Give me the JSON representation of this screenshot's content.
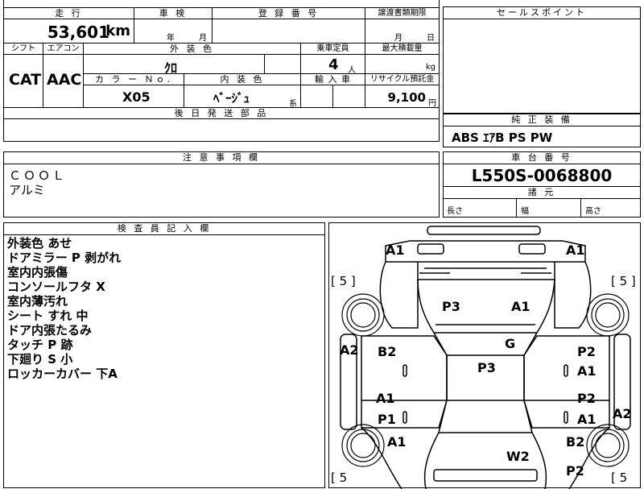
{
  "top": {
    "headers": {
      "mileage": "走 行",
      "inspection": "車 検",
      "registration": "登 録 番 号",
      "transfer_deadline": "譲渡書類期限"
    },
    "mileage_value": "53,601",
    "mileage_unit": "km",
    "inspection_year": "年",
    "inspection_month": "月",
    "deadline_month": "月",
    "deadline_day": "日",
    "headers2": {
      "shift": "シフト",
      "aircon": "エアコン",
      "exterior_color": "外 装 色",
      "capacity": "乗車定員",
      "max_load": "最大積載量"
    },
    "shift_value": "CAT",
    "aircon_value": "AAC",
    "exterior_color_value": "ｸﾛ",
    "capacity_value": "4",
    "capacity_unit": "人",
    "load_unit": "kg",
    "headers3": {
      "color_no": "カ ラ ー Ｎｏ.",
      "interior_color": "内 装 色",
      "import": "輸 入 車",
      "recycle": "リサイクル預託金"
    },
    "color_no_value": "X05",
    "interior_color_value": "ﾍﾞｰｼﾞｭ",
    "interior_color_suffix": "系",
    "recycle_value": "9,100",
    "recycle_unit": "円",
    "later_parts": "後 日 発 送 部 品"
  },
  "sales_point": {
    "header": "セールスポイント"
  },
  "equipment": {
    "header": "純 正 装 備",
    "value": "ABS ｴｱB PS PW"
  },
  "caution": {
    "header": "注 意 事 項 欄",
    "lines": [
      "ＣＯＯＬ",
      "アルミ"
    ]
  },
  "chassis": {
    "header": "車 台 番 号",
    "value": "L550S-0068800",
    "spec_header": "諸 元",
    "length": "長さ",
    "width": "幅",
    "height": "高さ"
  },
  "inspector": {
    "header": "検 査 員 記 入 欄",
    "notes": [
      "外装色 あせ",
      "ドアミラー P 剥がれ",
      "室内内張傷",
      "コンソールフタ X",
      "室内薄汚れ",
      "シート すれ 中",
      "ドア内張たるみ",
      "タッチ P 跡",
      "下廻り S 小",
      "ロッカーカバー 下A"
    ]
  },
  "diagram": {
    "tire_left_top": "[ 5 ]",
    "tire_right_top": "[ 5 ]",
    "tire_left_bottom": "[ 5",
    "tire_right_bottom": "[ 5",
    "marks": {
      "front_left": "A1",
      "front_right": "A1",
      "hood_left": "P3",
      "hood_right": "A1",
      "left_fender": "A2",
      "left_front_door": "B2",
      "windshield": "G",
      "roof": "P3",
      "right_front_door_a": "P2",
      "right_front_door_b": "A1",
      "left_rear_door_a": "A1",
      "left_rear_door_b": "P1",
      "right_rear_door_a": "P2",
      "right_rear_door_b": "A1",
      "right_rear": "A2",
      "left_rear_fender": "A1",
      "rear_glass": "W2",
      "right_rear_fender": "B2",
      "rear_bumper": "P2"
    }
  }
}
